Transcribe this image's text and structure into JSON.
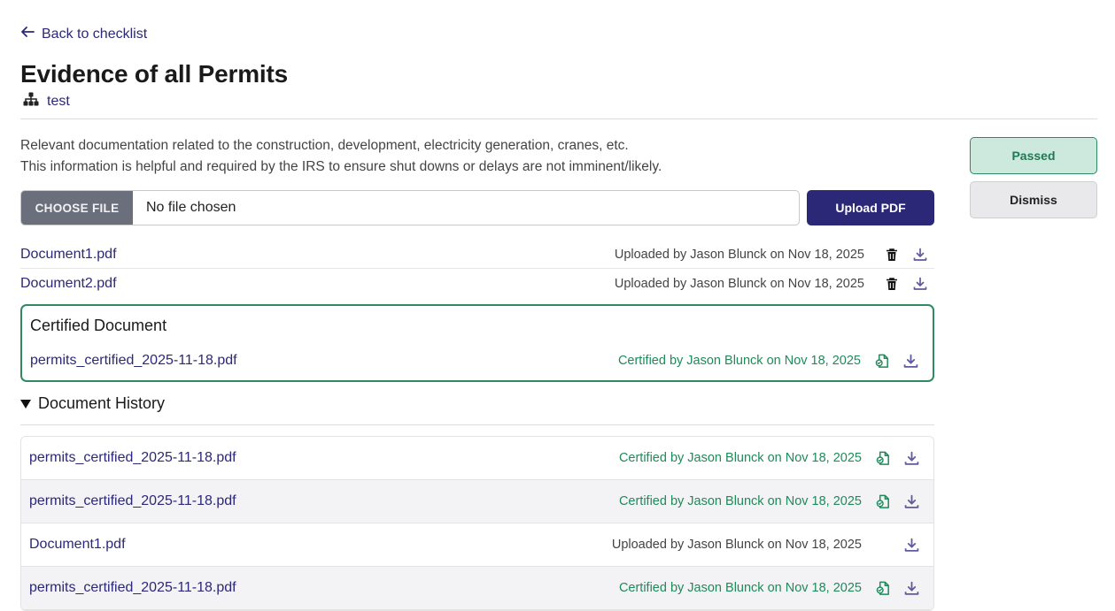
{
  "nav": {
    "back_label": "Back to checklist"
  },
  "page": {
    "title": "Evidence of all Permits",
    "organization": "test",
    "description_line1": "Relevant documentation related to the construction, development, electricity generation, cranes, etc.",
    "description_line2": "This information is helpful and required by the IRS to ensure shut downs or delays are not imminent/likely."
  },
  "upload": {
    "choose_label": "CHOOSE FILE",
    "file_status": "No file chosen",
    "upload_label": "Upload PDF"
  },
  "actions": {
    "passed_label": "Passed",
    "dismiss_label": "Dismiss"
  },
  "documents": [
    {
      "name": "Document1.pdf",
      "meta": "Uploaded by Jason Blunck on Nov 18, 2025"
    },
    {
      "name": "Document2.pdf",
      "meta": "Uploaded by Jason Blunck on Nov 18, 2025"
    }
  ],
  "certified": {
    "heading": "Certified Document",
    "name": "permits_certified_2025-11-18.pdf",
    "meta": "Certified by Jason Blunck on Nov 18, 2025"
  },
  "history": {
    "heading": "Document History",
    "items": [
      {
        "name": "permits_certified_2025-11-18.pdf",
        "meta": "Certified by Jason Blunck on Nov 18, 2025",
        "status": "certified"
      },
      {
        "name": "permits_certified_2025-11-18.pdf",
        "meta": "Certified by Jason Blunck on Nov 18, 2025",
        "status": "certified"
      },
      {
        "name": "Document1.pdf",
        "meta": "Uploaded by Jason Blunck on Nov 18, 2025",
        "status": "uploaded"
      },
      {
        "name": "permits_certified_2025-11-18.pdf",
        "meta": "Certified by Jason Blunck on Nov 18, 2025",
        "status": "certified"
      }
    ]
  },
  "colors": {
    "brand": "#2c2878",
    "success": "#2e8a63",
    "success_bg": "#cde8dc",
    "muted_button": "#6b6f7c"
  },
  "icons": {
    "back": "arrow-left-icon",
    "organization": "sitemap-icon",
    "delete": "trash-icon",
    "download": "download-icon",
    "certified": "certified-file-icon"
  }
}
